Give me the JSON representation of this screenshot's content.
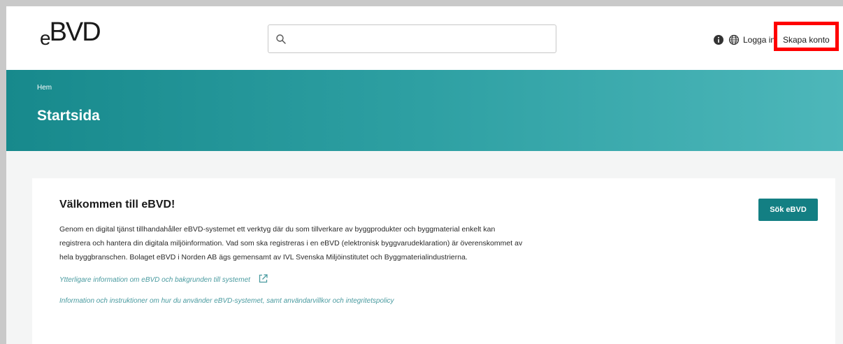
{
  "header": {
    "logo_e": "e",
    "logo_bvd": "BVD",
    "search": {
      "value": "",
      "placeholder": ""
    },
    "login_label": "Logga in",
    "create_account_label": "Skapa konto"
  },
  "banner": {
    "breadcrumb": "Hem",
    "title": "Startsida"
  },
  "card": {
    "title": "Välkommen till eBVD!",
    "intro_lines": [
      "Genom en digital tjänst tillhandahåller eBVD-systemet ett verktyg där du som tillverkare av byggprodukter och byggmaterial enkelt kan",
      "registrera och hantera din digitala miljöinformation. Vad som ska registreras i en eBVD (elektronisk byggvarudeklaration) är överenskommet av",
      "hela byggbranschen. Bolaget eBVD i Norden AB ägs gemensamt av IVL Svenska Miljöinstitutet och Byggmaterialindustrierna."
    ],
    "link_more_info": "Ytterligare information om eBVD och bakgrunden till systemet",
    "link_instructions": "Information och instruktioner om hur du använder eBVD-systemet, samt användarvillkor och integritetspolicy",
    "search_button": "Sök eBVD"
  },
  "icons": {
    "search": "search-icon",
    "info": "info-icon",
    "language": "globe-icon",
    "external": "external-link-icon"
  },
  "colors": {
    "brand_teal": "#137f83",
    "banner_start": "#17898c",
    "banner_end": "#4db7ba",
    "link": "#4a9ba0",
    "highlight": "#ff0000"
  }
}
